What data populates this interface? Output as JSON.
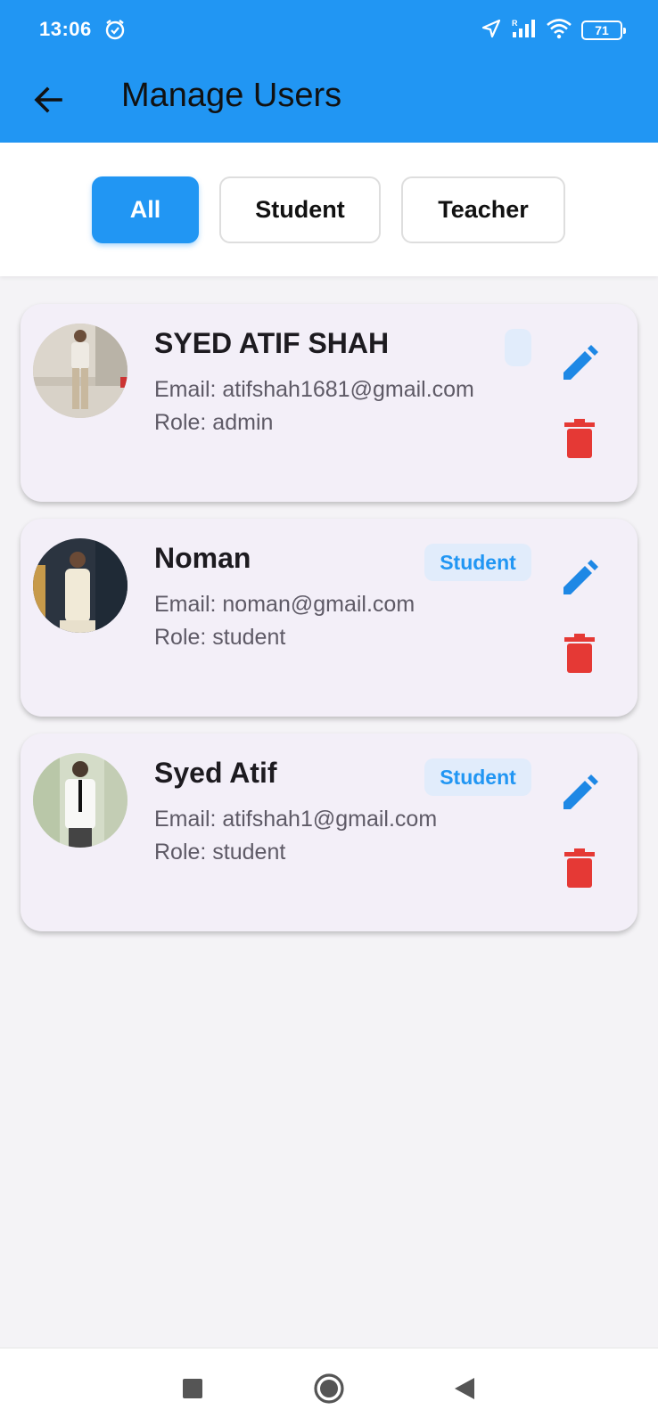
{
  "status_bar": {
    "time": "13:06",
    "battery": "71",
    "icons": [
      "alarm-icon",
      "location-icon",
      "signal-icon",
      "wifi-icon",
      "battery-icon"
    ]
  },
  "app_bar": {
    "title": "Manage Users",
    "back_icon": "arrow-left-icon",
    "color": "#2196f3"
  },
  "filters": {
    "items": [
      "All",
      "Student",
      "Teacher"
    ],
    "selected": "All"
  },
  "users": [
    {
      "name": "SYED ATIF SHAH",
      "email": "Email: atifshah1681@gmail.com",
      "role": "Role: admin",
      "badge": ""
    },
    {
      "name": "Noman",
      "email": "Email: noman@gmail.com",
      "role": "Role: student",
      "badge": "Student"
    },
    {
      "name": "Syed Atif",
      "email": "Email: atifshah1@gmail.com",
      "role": "Role: student",
      "badge": "Student"
    }
  ],
  "colors": {
    "accent": "#2196f3",
    "delete": "#e53935",
    "card": "#f3eff8",
    "badge_bg": "#e1ecfb"
  },
  "nav_bar": {
    "icons": [
      "recents-square-icon",
      "home-circle-icon",
      "back-triangle-icon"
    ]
  }
}
